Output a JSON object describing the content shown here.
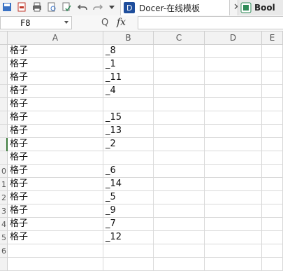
{
  "toolbar": {
    "tabs": [
      {
        "label": "Docer-在线模板"
      },
      {
        "label": "Bool"
      }
    ]
  },
  "formula_bar": {
    "name_box": "F8",
    "fx_label": "fx",
    "formula": ""
  },
  "columns": [
    "A",
    "B",
    "C",
    "D",
    "E"
  ],
  "rows": [
    {
      "header": "",
      "a": "格子",
      "b": "_8"
    },
    {
      "header": "",
      "a": "格子",
      "b": "_1"
    },
    {
      "header": "",
      "a": "格子",
      "b": "_11"
    },
    {
      "header": "",
      "a": "格子",
      "b": "_4"
    },
    {
      "header": "",
      "a": "格子",
      "b": ""
    },
    {
      "header": "",
      "a": "格子",
      "b": "_15"
    },
    {
      "header": "",
      "a": "格子",
      "b": "_13"
    },
    {
      "header": "",
      "a": "格子",
      "b": "_2"
    },
    {
      "header": "",
      "a": "格子",
      "b": ""
    },
    {
      "header": "0",
      "a": "格子",
      "b": "_6"
    },
    {
      "header": "1",
      "a": "格子",
      "b": "_14"
    },
    {
      "header": "2",
      "a": "格子",
      "b": "_5"
    },
    {
      "header": "3",
      "a": "格子",
      "b": "_9"
    },
    {
      "header": "4",
      "a": "格子",
      "b": "_7"
    },
    {
      "header": "5",
      "a": "格子",
      "b": "_12"
    },
    {
      "header": "6",
      "a": "",
      "b": ""
    },
    {
      "header": "",
      "a": "",
      "b": ""
    }
  ]
}
